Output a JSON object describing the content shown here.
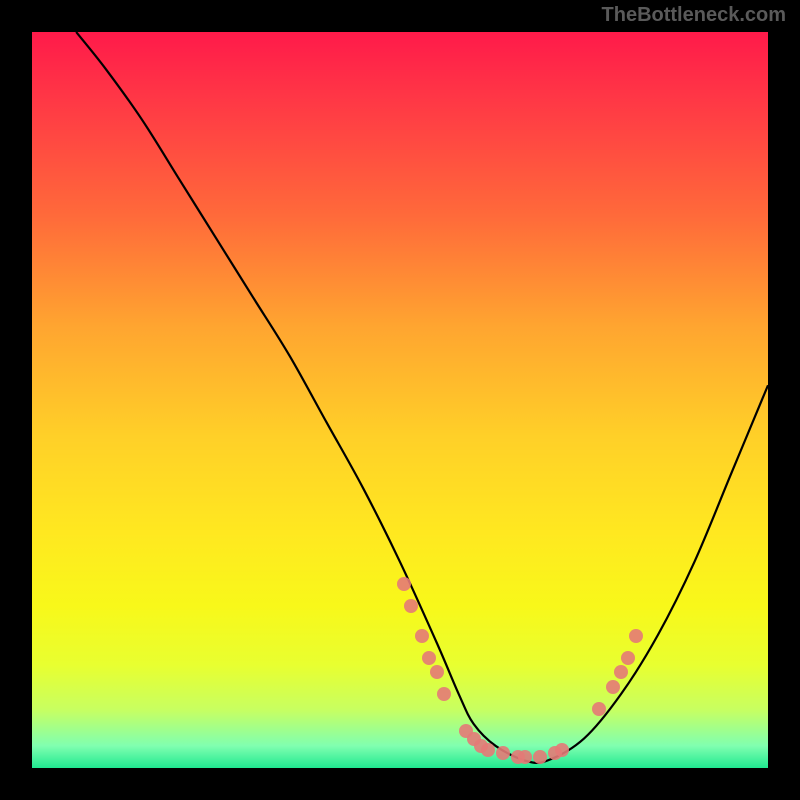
{
  "watermark": "TheBottleneck.com",
  "chart_data": {
    "type": "line",
    "title": "",
    "xlabel": "",
    "ylabel": "",
    "xlim": [
      0,
      100
    ],
    "ylim": [
      0,
      100
    ],
    "grid": false,
    "series": [
      {
        "name": "curve",
        "x": [
          6,
          10,
          15,
          20,
          25,
          30,
          35,
          40,
          45,
          50,
          55,
          58,
          60,
          63,
          67,
          70,
          75,
          80,
          85,
          90,
          95,
          100
        ],
        "y": [
          100,
          95,
          88,
          80,
          72,
          64,
          56,
          47,
          38,
          28,
          17,
          10,
          6,
          3,
          1,
          1,
          4,
          10,
          18,
          28,
          40,
          52
        ]
      }
    ],
    "points": [
      {
        "x": 50.5,
        "y": 25
      },
      {
        "x": 51.5,
        "y": 22
      },
      {
        "x": 53,
        "y": 18
      },
      {
        "x": 54,
        "y": 15
      },
      {
        "x": 55,
        "y": 13
      },
      {
        "x": 56,
        "y": 10
      },
      {
        "x": 59,
        "y": 5
      },
      {
        "x": 60,
        "y": 4
      },
      {
        "x": 61,
        "y": 3
      },
      {
        "x": 62,
        "y": 2.5
      },
      {
        "x": 64,
        "y": 2
      },
      {
        "x": 66,
        "y": 1.5
      },
      {
        "x": 67,
        "y": 1.5
      },
      {
        "x": 69,
        "y": 1.5
      },
      {
        "x": 71,
        "y": 2
      },
      {
        "x": 72,
        "y": 2.5
      },
      {
        "x": 77,
        "y": 8
      },
      {
        "x": 79,
        "y": 11
      },
      {
        "x": 80,
        "y": 13
      },
      {
        "x": 81,
        "y": 15
      },
      {
        "x": 82,
        "y": 18
      }
    ],
    "background_gradient": {
      "top": "#ff1a4a",
      "middle": "#ffe820",
      "bottom": "#20e890"
    },
    "curve_color": "#000000",
    "point_color": "#e47a77"
  }
}
